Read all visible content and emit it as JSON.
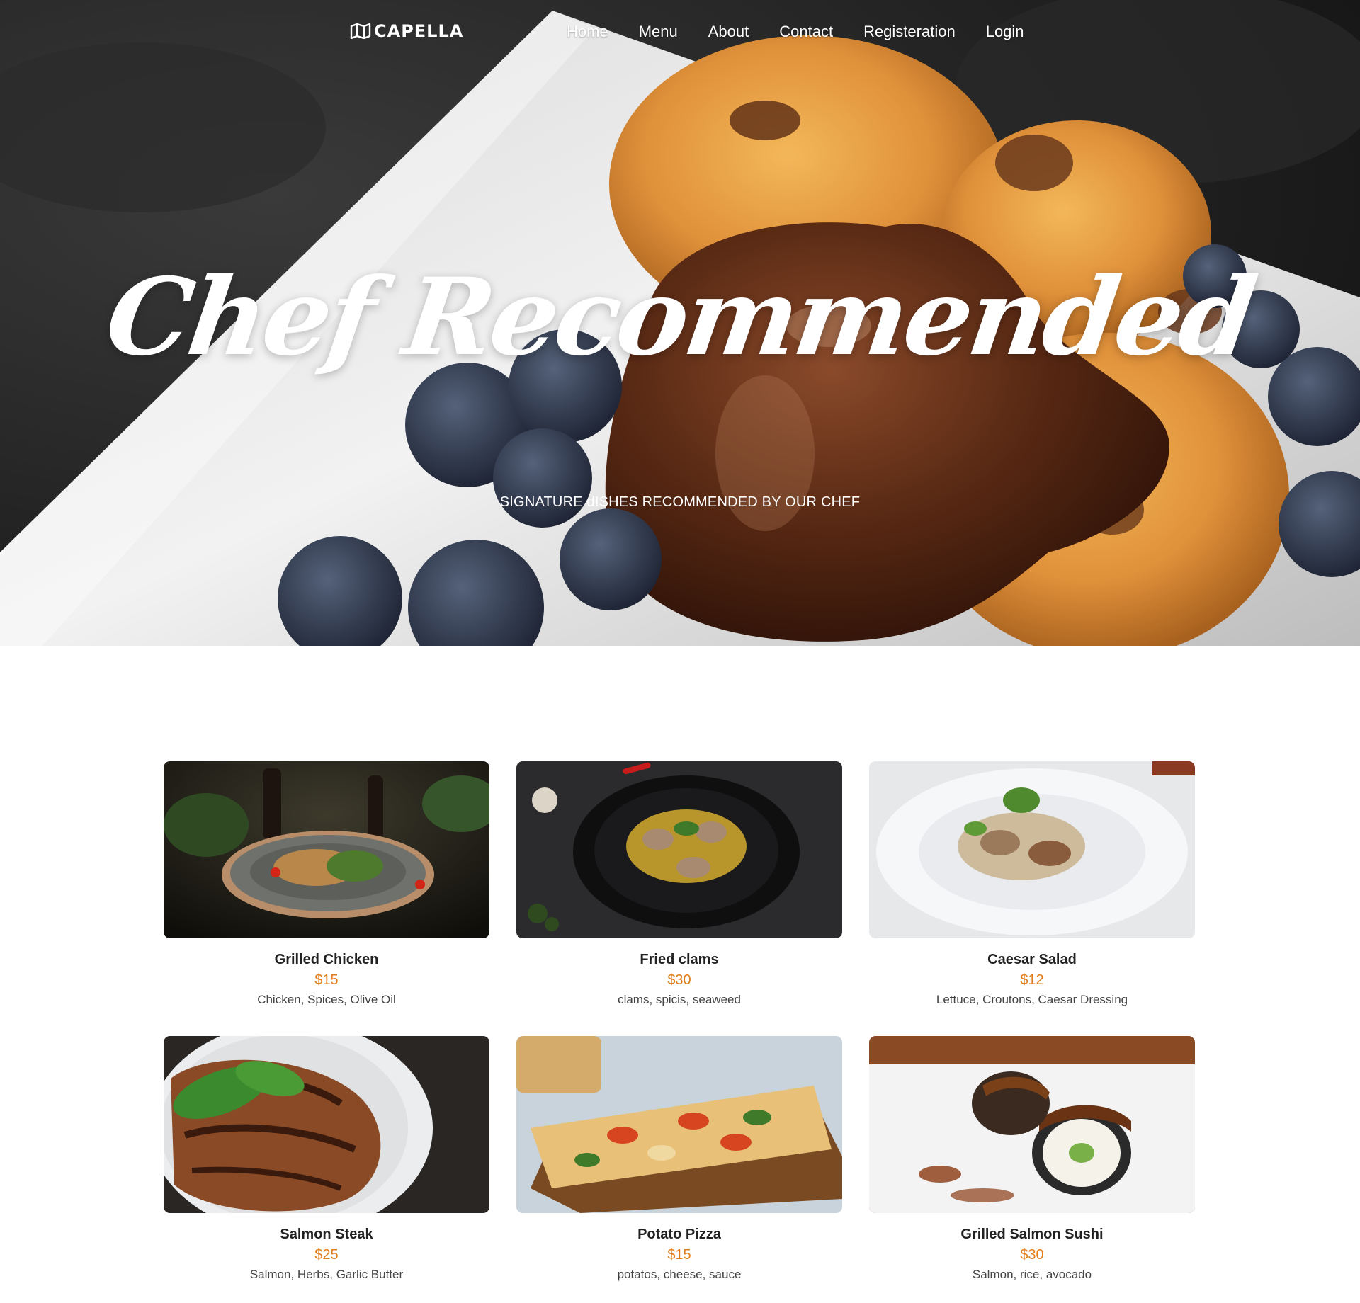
{
  "brand": {
    "name": "CAPELLA",
    "icon": "map-icon"
  },
  "nav": {
    "items": [
      {
        "label": "Home"
      },
      {
        "label": "Menu"
      },
      {
        "label": "About"
      },
      {
        "label": "Contact"
      },
      {
        "label": "Registeration"
      },
      {
        "label": "Login"
      }
    ]
  },
  "hero": {
    "title": "Chef Recommended",
    "subtitle": "SIGNATURE dISHES RECOMMENDED BY OUR CHEF"
  },
  "colors": {
    "price": "#e07d1a",
    "text_dark": "#222222",
    "text_muted": "#444444"
  },
  "dishes": [
    {
      "name": "Grilled Chicken",
      "price": "$15",
      "ingredients": "Chicken, Spices, Olive Oil"
    },
    {
      "name": "Fried clams",
      "price": "$30",
      "ingredients": "clams, spicis, seaweed"
    },
    {
      "name": "Caesar Salad",
      "price": "$12",
      "ingredients": "Lettuce, Croutons, Caesar Dressing"
    },
    {
      "name": "Salmon Steak",
      "price": "$25",
      "ingredients": "Salmon, Herbs, Garlic Butter"
    },
    {
      "name": "Potato Pizza",
      "price": "$15",
      "ingredients": "potatos, cheese, sauce"
    },
    {
      "name": "Grilled Salmon Sushi",
      "price": "$30",
      "ingredients": "Salmon, rice, avocado"
    }
  ]
}
